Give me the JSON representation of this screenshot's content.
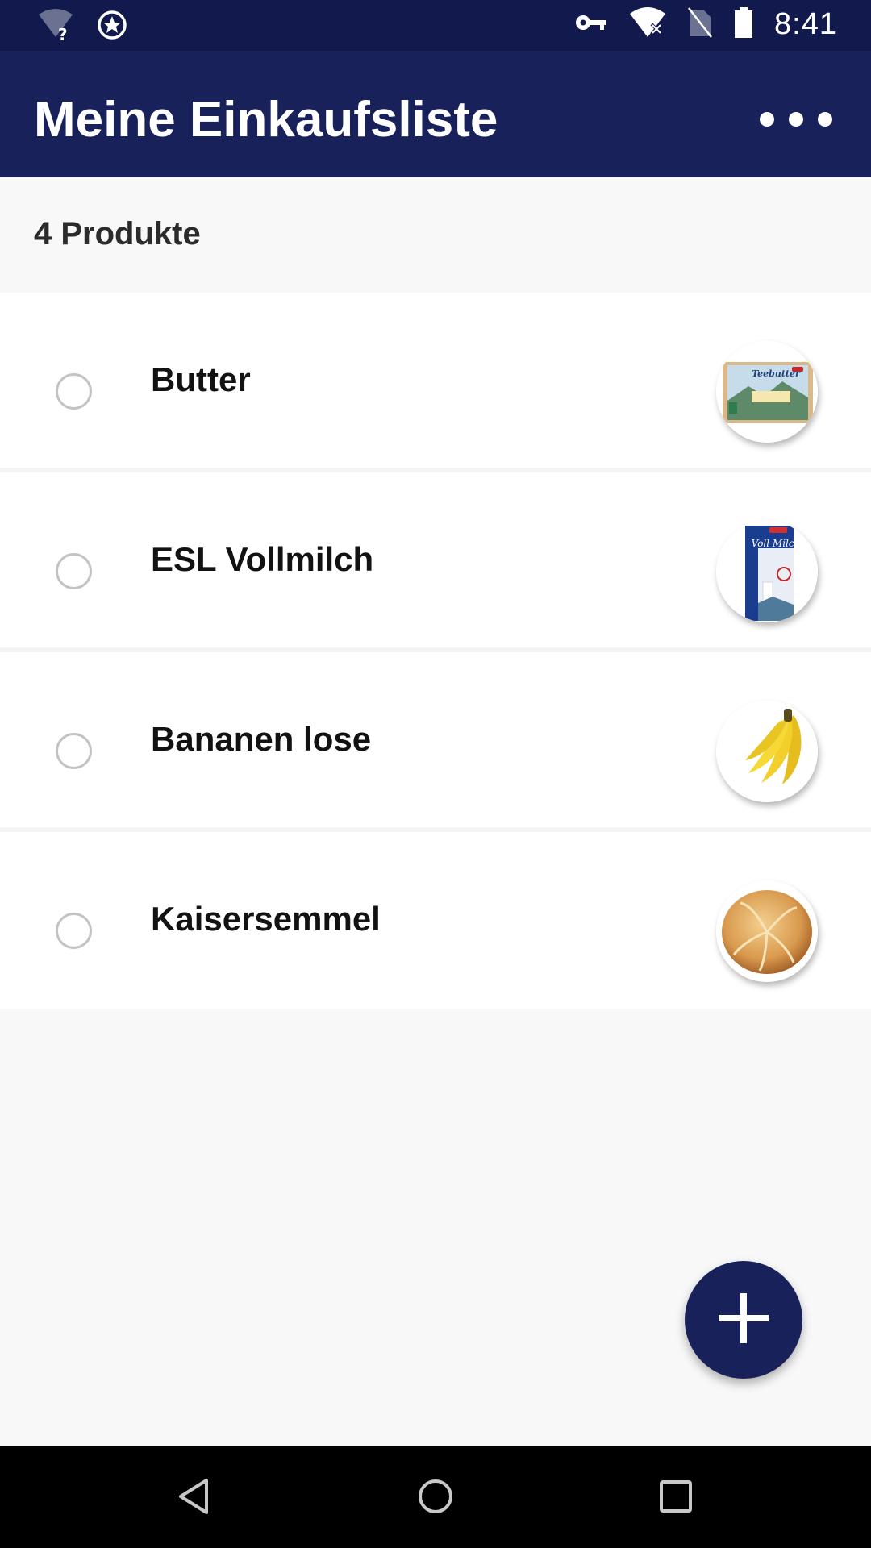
{
  "status_bar": {
    "time": "8:41",
    "icons": [
      "wifi-unknown-icon",
      "star-badge-icon",
      "vpn-key-icon",
      "wifi-off-icon",
      "no-sim-icon",
      "battery-icon"
    ]
  },
  "app_bar": {
    "title": "Meine Einkaufsliste",
    "menu_icon": "more-horizontal-icon"
  },
  "summary": {
    "count_label": "4 Produkte"
  },
  "items": [
    {
      "label": "Butter",
      "image": "butter-package-image",
      "checked": false
    },
    {
      "label": "ESL Vollmilch",
      "image": "milk-carton-image",
      "checked": false
    },
    {
      "label": "Bananen lose",
      "image": "bananas-image",
      "checked": false
    },
    {
      "label": "Kaisersemmel",
      "image": "bread-roll-image",
      "checked": false
    }
  ],
  "product_image_text": {
    "butter_package": "Teebutter",
    "milk_carton": "Voll Milch"
  },
  "fab": {
    "icon": "plus-icon"
  },
  "nav_bar": {
    "buttons": [
      "back-icon",
      "home-icon",
      "recents-icon"
    ]
  },
  "colors": {
    "primary": "#182159",
    "status_bar": "#121a4d",
    "background": "#f8f8f8"
  }
}
